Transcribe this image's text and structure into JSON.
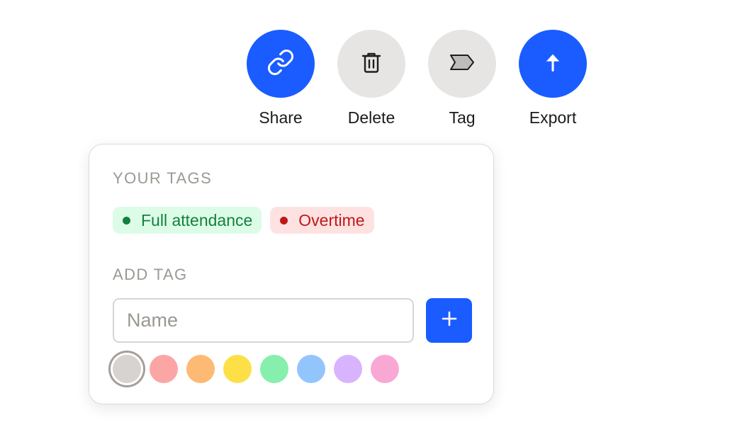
{
  "toolbar": {
    "actions": [
      {
        "label": "Share",
        "icon": "link-icon",
        "color": "#1a5cff"
      },
      {
        "label": "Delete",
        "icon": "trash-icon",
        "color": "#e6e5e3"
      },
      {
        "label": "Tag",
        "icon": "tag-icon",
        "color": "#e6e5e3"
      },
      {
        "label": "Export",
        "icon": "arrow-up-icon",
        "color": "#1a5cff"
      }
    ]
  },
  "tag_panel": {
    "your_tags_title": "YOUR TAGS",
    "tags": [
      {
        "label": "Full attendance",
        "text_color": "#15803d",
        "bg_color": "#dcfce7",
        "dot_color": "#15803d"
      },
      {
        "label": "Overtime",
        "text_color": "#c01818",
        "bg_color": "#fee2e2",
        "dot_color": "#c01818"
      }
    ],
    "add_tag_title": "ADD TAG",
    "name_input": {
      "placeholder": "Name",
      "value": ""
    },
    "add_button_icon": "plus-icon",
    "colors": [
      {
        "name": "gray",
        "hex": "#d6d3d1",
        "selected": true
      },
      {
        "name": "red",
        "hex": "#fca5a5",
        "selected": false
      },
      {
        "name": "orange",
        "hex": "#fdba74",
        "selected": false
      },
      {
        "name": "yellow",
        "hex": "#fde047",
        "selected": false
      },
      {
        "name": "green",
        "hex": "#86efac",
        "selected": false
      },
      {
        "name": "blue",
        "hex": "#93c5fd",
        "selected": false
      },
      {
        "name": "purple",
        "hex": "#d8b4fe",
        "selected": false
      },
      {
        "name": "pink",
        "hex": "#f9a8d4",
        "selected": false
      }
    ]
  }
}
